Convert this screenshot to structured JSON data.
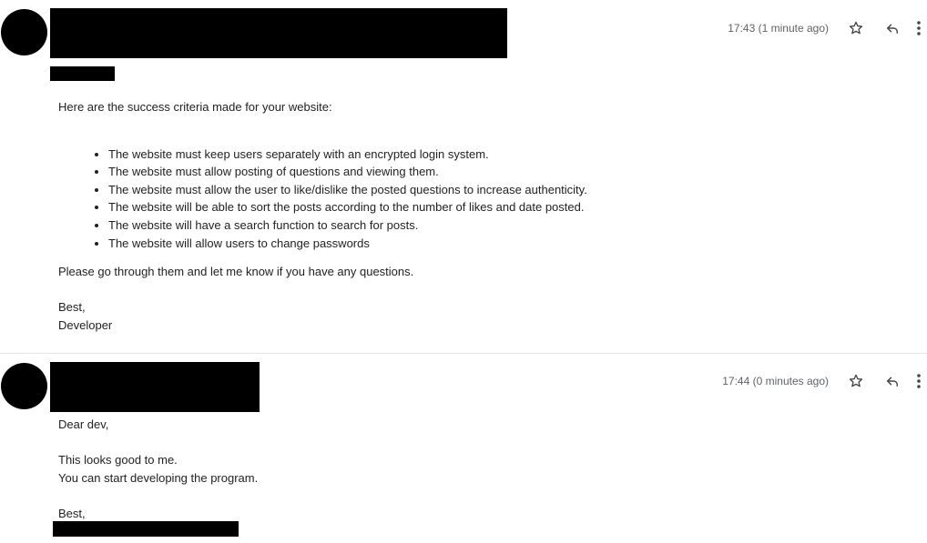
{
  "messages": [
    {
      "time": "17:43 (1 minute ago)",
      "intro": "Here are the success criteria made for your website:",
      "criteria": [
        "The website must keep users separately with an encrypted login system.",
        "The website must allow posting of questions and viewing them.",
        "The website must allow the user to like/dislike the posted questions to increase authenticity.",
        "The website will be able to sort the posts according to the number of likes and date posted.",
        "The website will have a search function to search for posts.",
        "The website will allow users to change passwords"
      ],
      "closing": "Please go through them and let me know if you have any questions.",
      "signoff": "Best,",
      "signature": "Developer"
    },
    {
      "time": "17:44 (0 minutes ago)",
      "greeting": "Dear dev,",
      "line1": "This looks good to me.",
      "line2": "You can start developing the program.",
      "signoff": "Best,"
    }
  ],
  "icons": {
    "star": "star-icon",
    "reply": "reply-icon",
    "more": "more-vert-icon"
  },
  "colors": {
    "text": "#222222",
    "meta": "#5f6368",
    "redaction": "#000000",
    "divider": "#e6e6e6"
  }
}
